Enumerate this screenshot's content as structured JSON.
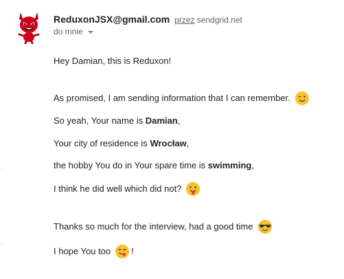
{
  "email": {
    "sender_address": "ReduxonJSX@gmail.com",
    "via_label": "przez",
    "via_domain": "sendgrid.net",
    "recipient_label": "do mnie"
  },
  "body": {
    "greeting": "Hey Damian, this is Reduxon!",
    "promise": "As promised, I am sending information that I can remember.",
    "name_prefix": "So yeah, Your name is ",
    "name_value": "Damian",
    "name_suffix": ",",
    "city_prefix": "Your city of residence is ",
    "city_value": "Wrocław",
    "city_suffix": ",",
    "hobby_prefix": "the hobby You do in Your spare time is ",
    "hobby_value": "swimming",
    "hobby_suffix": ",",
    "question": "I think he did well which did not?",
    "thanks": "Thanks so much for the interview, had a good time",
    "hope": "I hope You too",
    "hope_suffix": "!"
  },
  "icons": {
    "avatar": "red-devil-mascot-icon",
    "wink": "winking-face-icon",
    "tongue": "face-with-tongue-icon",
    "sunglasses": "smiling-face-with-sunglasses-icon",
    "savoring": "face-savoring-food-icon"
  },
  "colors": {
    "emoji_yellow": "#fbc02d",
    "devil_red": "#d0021b",
    "muted_text": "#5f6368"
  }
}
